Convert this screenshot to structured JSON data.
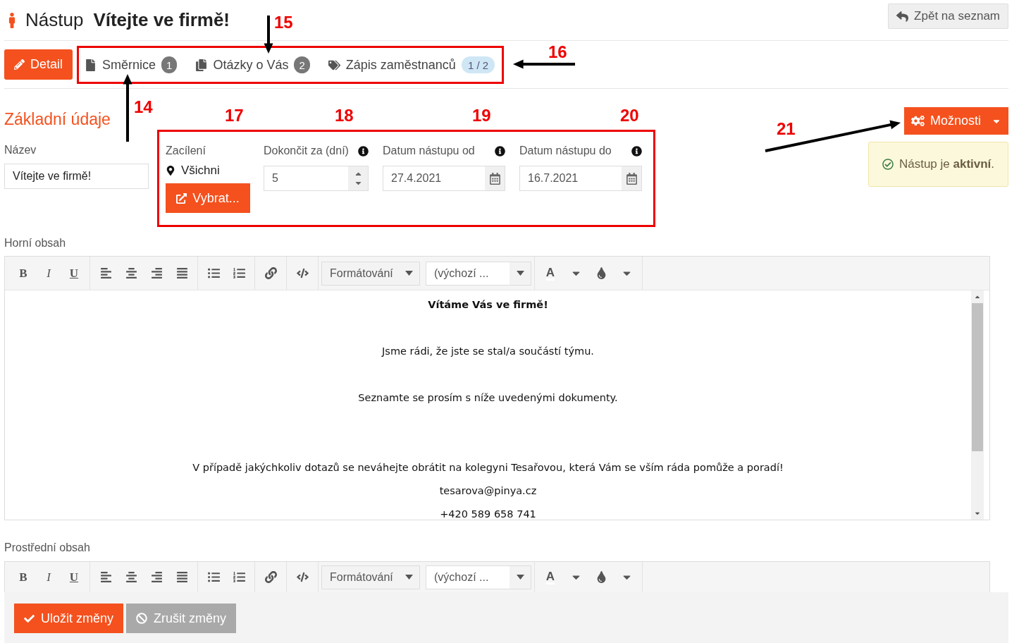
{
  "header": {
    "module": "Nástup",
    "title": "Vítejte ve firmě!",
    "back_button": "Zpět na seznam"
  },
  "tabs": [
    {
      "label": "Detail",
      "selected": true
    },
    {
      "label": "Směrnice",
      "badge": "1",
      "kind": "count",
      "selected": false
    },
    {
      "label": "Otázky o Vás",
      "badge": "2",
      "kind": "count",
      "selected": false
    },
    {
      "label": "Zápis zaměstnanců",
      "badge": "1 / 2",
      "kind": "progress",
      "selected": false
    }
  ],
  "section_title": "Základní údaje",
  "options_button": "Možnosti",
  "alert": "Nástup je **aktivní**.",
  "name_field": {
    "label": "Název",
    "value": "Vítejte ve firmě!"
  },
  "targeting": {
    "label": "Zacílení",
    "value": "Všichni",
    "button": "Vybrat..."
  },
  "days_field": {
    "label": "Dokončit za (dní)",
    "value": "5"
  },
  "date_fields": [
    {
      "label": "Datum nástupu od",
      "value": "27.4.2021"
    },
    {
      "label": "Datum nástupu do",
      "value": "16.7.2021"
    }
  ],
  "editors": [
    {
      "label": "Horní obsah",
      "toolbar": {
        "bold": "B",
        "italic": "I",
        "underline": "U",
        "format": "Formátování",
        "font": "(výchozí ...",
        "text_color_label": "A"
      },
      "content": [
        {
          "kind": "heading",
          "text": "Vítáme Vás ve firmě!"
        },
        {
          "kind": "paragraph",
          "text": "Jsme rádi, že jste se stal/a součástí týmu."
        },
        {
          "kind": "paragraph",
          "text": "Seznamte se prosím s níže uvedenými dokumenty."
        },
        {
          "kind": "wide",
          "text": "V případě jakýchkoliv dotazů se neváhejte obrátit na kolegyni Tesařovou, která Vám se vším ráda pomůže a poradí!"
        },
        {
          "kind": "line",
          "text": "tesarova@pinya.cz"
        },
        {
          "kind": "line",
          "text": "+420 589 658 741"
        }
      ]
    },
    {
      "label": "Prostřední obsah",
      "toolbar": {
        "bold": "B",
        "italic": "I",
        "underline": "U",
        "format": "Formátování",
        "font": "(výchozí ...",
        "text_color_label": "A"
      }
    }
  ],
  "actions": [
    {
      "label": "Uložit změny",
      "kind": "primary"
    },
    {
      "label": "Zrušit změny",
      "kind": "secondary"
    }
  ],
  "annotations": [
    "15",
    "16",
    "14",
    "17",
    "18",
    "19",
    "20",
    "21"
  ]
}
